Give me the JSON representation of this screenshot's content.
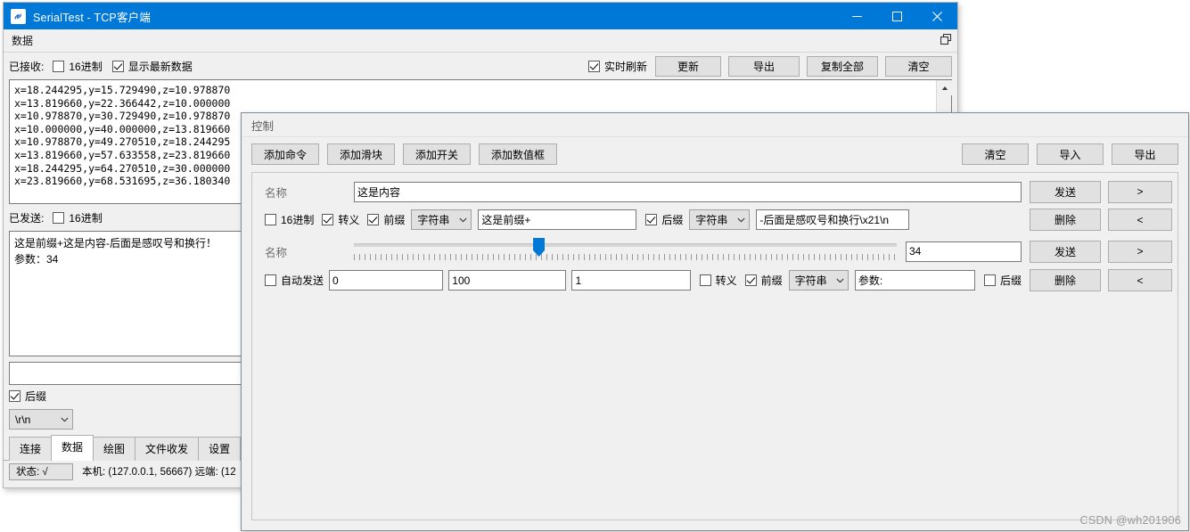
{
  "main_window": {
    "title": "SerialTest - TCP客户端",
    "app_icon": "link-icon",
    "window_buttons": {
      "minimize": "minimize-icon",
      "maximize": "maximize-icon",
      "close": "close-icon"
    },
    "menu": {
      "label": "数据",
      "float_icon": "restore-window-icon"
    },
    "received": {
      "label": "已接收:",
      "hex_label": "16进制",
      "hex_checked": false,
      "latest_label": "显示最新数据",
      "latest_checked": true,
      "realtime_label": "实时刷新",
      "realtime_checked": true,
      "buttons": [
        "更新",
        "导出",
        "复制全部",
        "清空"
      ],
      "lines": [
        "x=18.244295,y=15.729490,z=10.978870",
        "x=13.819660,y=22.366442,z=10.000000",
        "x=10.978870,y=30.729490,z=10.978870",
        "x=10.000000,y=40.000000,z=13.819660",
        "x=10.978870,y=49.270510,z=18.244295",
        "x=13.819660,y=57.633558,z=23.819660",
        "x=18.244295,y=64.270510,z=30.000000",
        "x=23.819660,y=68.531695,z=36.180340"
      ]
    },
    "sent": {
      "label": "已发送:",
      "hex_label": "16进制",
      "hex_checked": false,
      "lines": [
        "这是前缀+这是内容-后面是感叹号和换行！",
        "参数：34"
      ]
    },
    "input_field_value": "",
    "suffix": {
      "label": "后缀",
      "checked": true,
      "value": "\\r\\n"
    },
    "tabs": [
      {
        "label": "连接",
        "active": false
      },
      {
        "label": "数据",
        "active": true
      },
      {
        "label": "绘图",
        "active": false
      },
      {
        "label": "文件收发",
        "active": false
      },
      {
        "label": "设置",
        "active": false
      }
    ],
    "status": {
      "state": "状态: √",
      "info": "本机: (127.0.0.1, 56667) 远端: (12"
    }
  },
  "control_dialog": {
    "title": "控制",
    "add_buttons": [
      "添加命令",
      "添加滑块",
      "添加开关",
      "添加数值框"
    ],
    "right_buttons": [
      "清空",
      "导入",
      "导出"
    ],
    "command_row": {
      "name_label": "名称",
      "name_value": "这是内容",
      "send_label": "发送",
      "arrow_right": ">",
      "hex_label": "16进制",
      "hex_checked": false,
      "escape_label": "转义",
      "escape_checked": true,
      "prefix_label": "前缀",
      "prefix_checked": true,
      "prefix_type": "字符串",
      "prefix_value": "这是前缀+",
      "suffix_label": "后缀",
      "suffix_checked": true,
      "suffix_type": "字符串",
      "suffix_value": "-后面是感叹号和换行\\x21\\n",
      "delete_label": "删除",
      "arrow_left": "<"
    },
    "slider_row": {
      "name_label": "名称",
      "slider_value": "34",
      "slider_min": 0,
      "slider_max": 100,
      "slider_percent": 34,
      "send_label": "发送",
      "arrow_right": ">",
      "auto_send_label": "自动发送",
      "auto_send_checked": false,
      "min_value": "0",
      "max_value": "100",
      "step_value": "1",
      "escape_label": "转义",
      "escape_checked": false,
      "prefix_label": "前缀",
      "prefix_checked": true,
      "prefix_type": "字符串",
      "prefix_value": "参数:",
      "suffix_label": "后缀",
      "suffix_checked": false,
      "delete_label": "删除",
      "arrow_left": "<"
    }
  },
  "watermark": "CSDN @wh201906",
  "colors": {
    "accent": "#0078d7",
    "window_bg": "#f0f0f0",
    "field_bg": "#ffffff",
    "button_bg": "#e1e1e1"
  }
}
